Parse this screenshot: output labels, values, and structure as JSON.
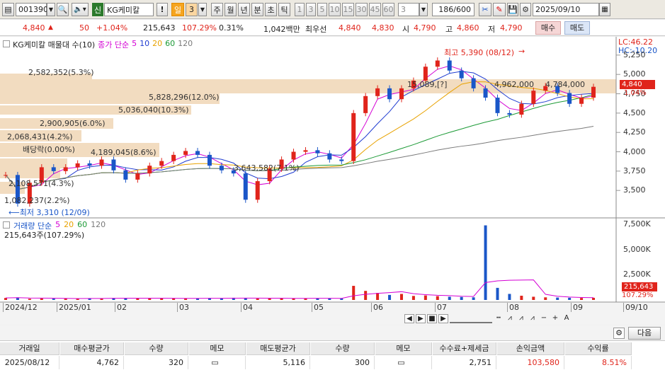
{
  "toolbar": {
    "code": "001390",
    "market": "신",
    "name": "KG케미칼",
    "excl": "!",
    "unit_day": "일",
    "unit_num": "3",
    "periods": [
      "주",
      "월",
      "년",
      "분",
      "초",
      "틱"
    ],
    "nums": [
      "1",
      "3",
      "5",
      "10",
      "15",
      "30",
      "45",
      "60"
    ],
    "minute_val": "3",
    "range": "186/600",
    "date": "2025/09/10"
  },
  "quote": {
    "price": "4,840",
    "change": "50",
    "change_pct": "+1.04%",
    "volume": "215,643",
    "vol_ratio": "107.29%",
    "turnover_rate": "0.31%",
    "amount": "1,042백만",
    "best_label": "최우선",
    "ask": "4,840",
    "bid": "4,830",
    "open_label": "시",
    "open": "4,790",
    "high_label": "고",
    "high": "4,860",
    "low_label": "저",
    "low": "4,790",
    "buy_btn": "매수",
    "sell_btn": "매도"
  },
  "price_panel": {
    "title": "KG케미칼 매물대 수(10)",
    "ma_label": "종가 단순",
    "ma_periods": [
      "5",
      "10",
      "20",
      "60",
      "120"
    ],
    "lc": "LC:46.22",
    "hc": "HC:-10.20",
    "max_label": "최고 5,390 (08/12)",
    "min_label": "최저 3,310 (12/09)",
    "dividend": "배당락(0.00%)",
    "current_tag": "4,840",
    "current_pct": "1.04%",
    "y_ticks": [
      "5,250",
      "5,000",
      "4,750",
      "4,500",
      "4,250",
      "4,000",
      "3,750",
      "3,500"
    ]
  },
  "volume_profile": [
    "2,582,352(5.3%)",
    "15,089,[?]",
    "4,962,000",
    "4,784,000",
    "5,828,296(12.0%)",
    "5,036,040(10.3%)",
    "2,900,905(6.0%)",
    "2,068,431(4.2%)",
    "4,189,045(8.6%)",
    "3,643,582(7.1%)",
    "2,108,571(4.3%)",
    "1,082,237(2.2%)"
  ],
  "volume_panel": {
    "title": "거래량 단순",
    "ma_periods": [
      "5",
      "20",
      "60",
      "120"
    ],
    "current": "215,643주(107.29%)",
    "y_ticks": [
      "7,500K",
      "5,000K",
      "2,500K"
    ],
    "tag_vol": "215,643",
    "tag_pct": "107.29%"
  },
  "x_axis": [
    "2024/12",
    "2025/01",
    "02",
    "03",
    "04",
    "05",
    "06",
    "07",
    "08",
    "09",
    "09/10"
  ],
  "history": {
    "next_btn": "다음",
    "columns": [
      "거래일",
      "매수평균가",
      "수량",
      "메모",
      "매도평균가",
      "수량",
      "메모",
      "수수료+제세금",
      "손익금액",
      "수익률"
    ],
    "row": [
      "2025/08/12",
      "4,762",
      "320",
      "",
      "5,116",
      "300",
      "",
      "2,751",
      "103,580",
      "8.51%"
    ]
  },
  "colors": {
    "up": "#e0241b",
    "down": "#1a56c8",
    "ma5": "#d400d4",
    "ma10": "#1f3cd1",
    "ma20": "#e8a200",
    "ma60": "#1c9a36",
    "ma120": "#7a7a7a",
    "profile": "#f2dcc0"
  },
  "chart_data": [
    {
      "type": "line",
      "title": "KG케미칼",
      "y_range": [
        3200,
        5450
      ],
      "x_range": [
        "2024/12",
        "2025/09/10"
      ],
      "series": [
        {
          "name": "종가",
          "values": [
            3700,
            3330,
            3600,
            3800,
            3750,
            3800,
            3850,
            3820,
            3900,
            3760,
            3640,
            3720,
            3820,
            3880,
            3960,
            4010,
            3960,
            3820,
            3760,
            3720,
            3380,
            3620,
            3780,
            3900,
            4000,
            4020,
            3980,
            3900,
            3880,
            4500,
            4720,
            4820,
            4680,
            4820,
            4920,
            5100,
            5180,
            5050,
            4950,
            4820,
            4700,
            4500,
            4480,
            4620,
            4790,
            4850,
            4760,
            4620,
            4700,
            4840
          ]
        }
      ]
    },
    {
      "type": "bar",
      "title": "거래량",
      "y_range": [
        0,
        8000
      ],
      "x_range": [
        "2024/12",
        "2025/09/10"
      ],
      "series": [
        {
          "name": "거래량",
          "values": [
            200,
            250,
            120,
            160,
            130,
            150,
            140,
            180,
            160,
            200,
            210,
            140,
            150,
            160,
            180,
            150,
            140,
            200,
            160,
            220,
            180,
            140,
            160,
            180,
            150,
            170,
            180,
            160,
            150,
            1400,
            900,
            700,
            500,
            600,
            400,
            450,
            380,
            320,
            300,
            260,
            7400,
            1200,
            600,
            420,
            320,
            260,
            240,
            220,
            200,
            215.6
          ]
        }
      ]
    }
  ]
}
